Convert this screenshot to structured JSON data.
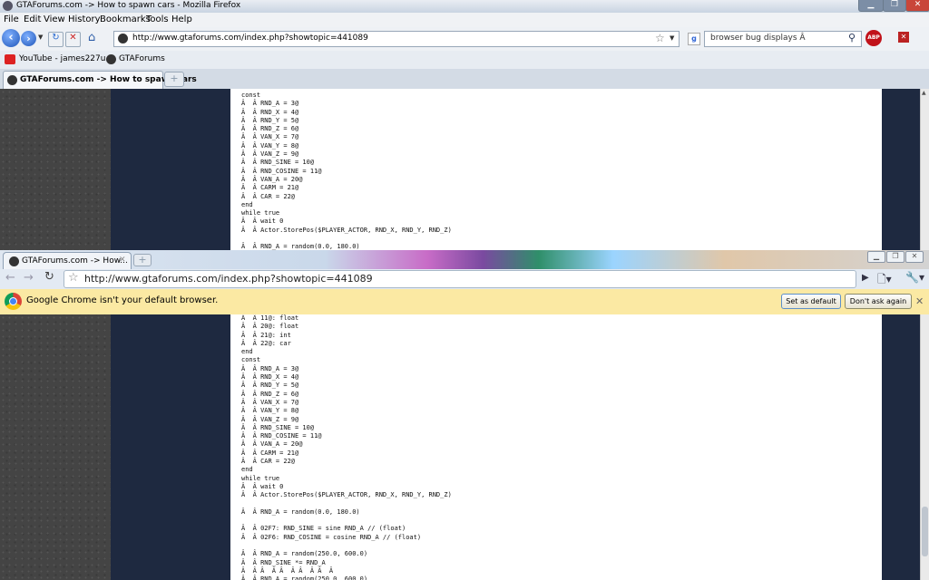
{
  "firefox": {
    "title": "GTAForums.com -> How to spawn cars - Mozilla Firefox",
    "menu": [
      "File",
      "Edit",
      "View",
      "History",
      "Bookmarks",
      "Tools",
      "Help"
    ],
    "url": "http://www.gtaforums.com/index.php?showtopic=441089",
    "search_value": "browser bug displays Â",
    "bookmarks": [
      "YouTube - james227u...",
      "GTAForums"
    ],
    "tab_label": "GTAForums.com -> How to spawn cars",
    "code": "const\nÂ  Â RND_A = 3@\nÂ  Â RND_X = 4@\nÂ  Â RND_Y = 5@\nÂ  Â RND_Z = 6@\nÂ  Â VAN_X = 7@\nÂ  Â VAN_Y = 8@\nÂ  Â VAN_Z = 9@\nÂ  Â RND_SINE = 10@\nÂ  Â RND_COSINE = 11@\nÂ  Â VAN_A = 20@\nÂ  Â CARM = 21@\nÂ  Â CAR = 22@\nend\nwhile true\nÂ  Â wait 0\nÂ  Â Actor.StorePos($PLAYER_ACTOR, RND_X, RND_Y, RND_Z)\n\nÂ  Â RND_A = random(0.0, 180.0)"
  },
  "chrome": {
    "tab_label": "GTAForums.com -> How...",
    "url": "http://www.gtaforums.com/index.php?showtopic=441089",
    "infobar_message": "Google Chrome isn't your default browser.",
    "set_default_label": "Set as default",
    "dont_ask_label": "Don't ask again",
    "code": "Â  Â 11@: float\nÂ  Â 20@: float\nÂ  Â 21@: int\nÂ  Â 22@: car\nend\nconst\nÂ  Â RND_A = 3@\nÂ  Â RND_X = 4@\nÂ  Â RND_Y = 5@\nÂ  Â RND_Z = 6@\nÂ  Â VAN_X = 7@\nÂ  Â VAN_Y = 8@\nÂ  Â VAN_Z = 9@\nÂ  Â RND_SINE = 10@\nÂ  Â RND_COSINE = 11@\nÂ  Â VAN_A = 20@\nÂ  Â CARM = 21@\nÂ  Â CAR = 22@\nend\nwhile true\nÂ  Â wait 0\nÂ  Â Actor.StorePos($PLAYER_ACTOR, RND_X, RND_Y, RND_Z)\n\nÂ  Â RND_A = random(0.0, 180.0)\n\nÂ  Â 02F7: RND_SINE = sine RND_A // (float)\nÂ  Â 02F6: RND_COSINE = cosine RND_A // (float)\n\nÂ  Â RND_A = random(250.0, 600.0)\nÂ  Â RND_SINE *= RND_A\nÂ  Â Â  Â Â  Â Â  Â Â  Â \nÂ  Â RND_A = random(250.0, 600.0)"
  },
  "colors": {
    "page_navy": "#1e2940",
    "infobar": "#fbe9a3"
  }
}
